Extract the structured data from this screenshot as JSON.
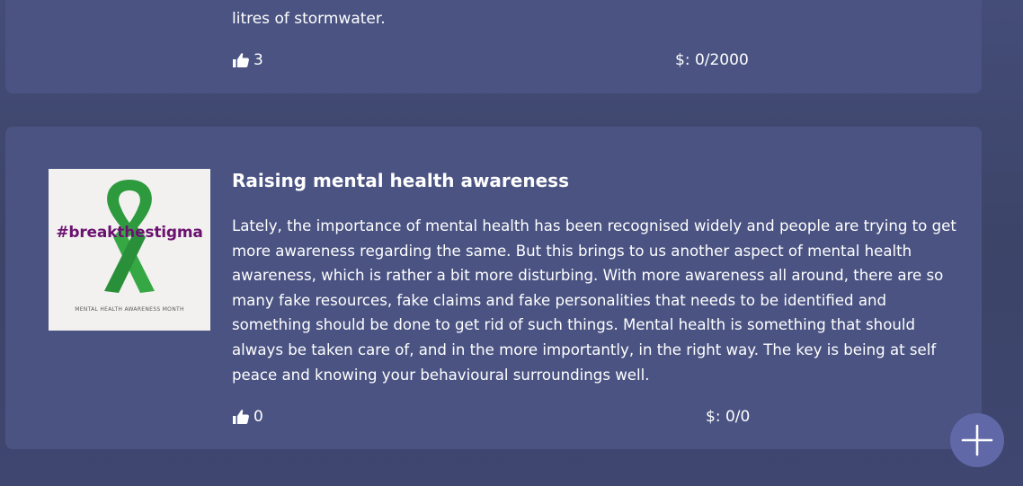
{
  "previous_post": {
    "body_tail": "litres of stormwater.",
    "likes": "3",
    "funding": "$: 0/2000"
  },
  "post": {
    "image": {
      "hashtag": "#breakthestigma",
      "month_label": "MENTAL HEALTH AWARENESS MONTH"
    },
    "title": "Raising mental health awareness",
    "body": "Lately, the importance of mental health has been recognised widely and people are trying to get more awareness regarding the same. But this brings to us another aspect of mental health awareness, which is rather a bit more disturbing. With more awareness all around, there are so many fake resources, fake claims and fake personalities that needs to be identified and something should be done to get rid of such things. Mental health is something that should always be taken care of, and in the more importantly, in the right way. The key is being at self peace and knowing your behavioural surroundings well.",
    "likes": "0",
    "funding": "$: 0/0"
  },
  "colors": {
    "background": "#3f4870",
    "card": "#4a5382",
    "fab": "#6068a8",
    "ribbon": "#2e9a3e",
    "hashtag": "#6b1170"
  },
  "icons": {
    "like": "thumbs-up-icon",
    "add": "plus-icon"
  }
}
